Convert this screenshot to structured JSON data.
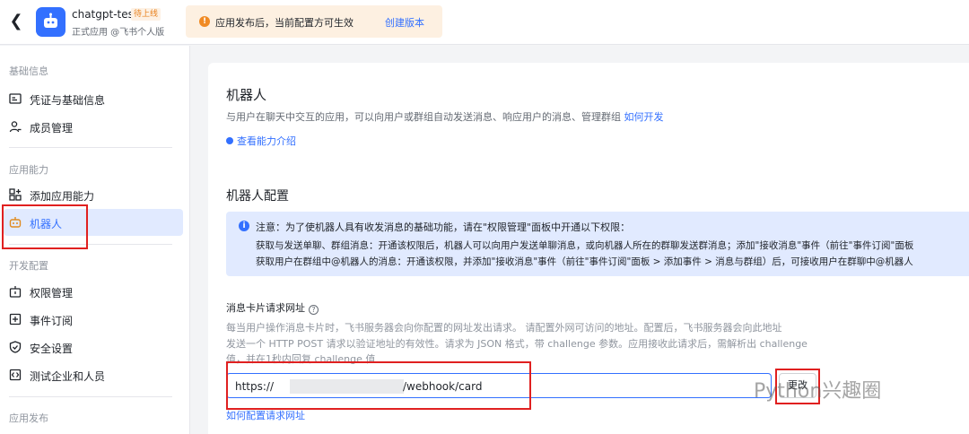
{
  "header": {
    "back_icon": "chevron-left-icon",
    "app_name": "chatgpt-test",
    "status": "待上线",
    "subtitle": "正式应用 @飞书个人版",
    "notice": "应用发布后，当前配置方可生效",
    "notice_link": "创建版本"
  },
  "sidebar": {
    "sections": [
      {
        "title": "基础信息",
        "items": [
          {
            "label": "凭证与基础信息",
            "icon": "credential-icon"
          },
          {
            "label": "成员管理",
            "icon": "member-icon"
          }
        ]
      },
      {
        "title": "应用能力",
        "items": [
          {
            "label": "添加应用能力",
            "icon": "add-capability-icon"
          },
          {
            "label": "机器人",
            "icon": "robot-icon",
            "active": true
          }
        ]
      },
      {
        "title": "开发配置",
        "items": [
          {
            "label": "权限管理",
            "icon": "permission-icon"
          },
          {
            "label": "事件订阅",
            "icon": "event-icon"
          },
          {
            "label": "安全设置",
            "icon": "shield-icon"
          },
          {
            "label": "测试企业和人员",
            "icon": "code-icon"
          }
        ]
      },
      {
        "title": "应用发布",
        "items": []
      }
    ]
  },
  "main": {
    "title": "机器人",
    "description": "与用户在聊天中交互的应用，可以向用户或群组自动发送消息、响应用户的消息、管理群组",
    "description_link": "如何开发",
    "capability_link": "查看能力介绍",
    "config_title": "机器人配置",
    "info": {
      "line1": "注意：为了使机器人具有收发消息的基础功能，请在\"权限管理\"面板中开通以下权限：",
      "line2": "获取与发送单聊、群组消息：开通该权限后，机器人可以向用户发送单聊消息，或向机器人所在的群聊发送群消息；添加\"接收消息\"事件（前往\"事件订阅\"面板",
      "line3": "获取用户在群组中@机器人的消息：开通该权限，并添加\"接收消息\"事件（前往\"事件订阅\"面板 > 添加事件 > 消息与群组）后，可接收用户在群聊中@机器人"
    },
    "field": {
      "label": "消息卡片请求网址",
      "help1": "每当用户操作消息卡片时，飞书服务器会向你配置的网址发出请求。 请配置外网可访问的地址。配置后，飞书服务器会向此地址",
      "help2": "发送一个 HTTP POST 请求以验证地址的有效性。请求为 JSON 格式，带 challenge 参数。应用接收此请求后，需解析出 challenge",
      "help3": "值，并在1秒内回复 challenge 值",
      "url_prefix": "https://",
      "url_suffix": "/webhook/card",
      "change_button": "更改",
      "how_link": "如何配置请求网址"
    }
  },
  "watermark": "Python兴趣圈",
  "colors": {
    "accent": "#3370ff",
    "highlight_box": "#e02020",
    "notice_bg": "#fdf0e1",
    "info_bg": "#e1eaff"
  }
}
